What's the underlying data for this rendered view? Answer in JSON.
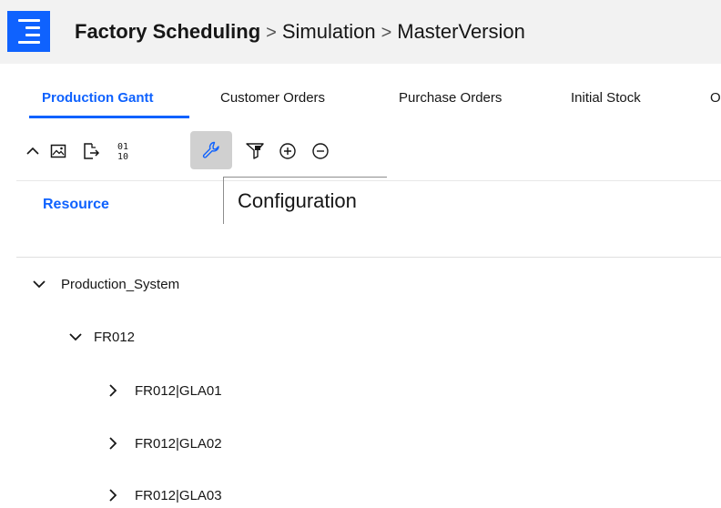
{
  "header": {
    "app_icon": "hamburger-menu-icon",
    "breadcrumb": {
      "app": "Factory Scheduling",
      "separator": ">",
      "level1": "Simulation",
      "level2": "MasterVersion"
    }
  },
  "tabs": [
    {
      "label": "Production Gantt",
      "active": true
    },
    {
      "label": "Customer Orders",
      "active": false
    },
    {
      "label": "Purchase Orders",
      "active": false
    },
    {
      "label": "Initial Stock",
      "active": false
    },
    {
      "label": "O",
      "active": false
    }
  ],
  "toolbar": {
    "items": [
      {
        "icon": "chevron-up-icon"
      },
      {
        "icon": "image-icon"
      },
      {
        "icon": "export-icon"
      },
      {
        "icon": "binary-icon"
      },
      {
        "icon": "wrench-icon",
        "active": true
      },
      {
        "icon": "filter-icon"
      },
      {
        "icon": "zoom-in-icon"
      },
      {
        "icon": "zoom-out-icon"
      }
    ],
    "tooltip": "Configuration"
  },
  "table": {
    "column_header": "Resource"
  },
  "tree": [
    {
      "label": "Production_System",
      "expanded": true,
      "level": 0
    },
    {
      "label": "FR012",
      "expanded": true,
      "level": 1
    },
    {
      "label": "FR012|GLA01",
      "expanded": false,
      "level": 2
    },
    {
      "label": "FR012|GLA02",
      "expanded": false,
      "level": 2
    },
    {
      "label": "FR012|GLA03",
      "expanded": false,
      "level": 2
    }
  ],
  "colors": {
    "accent": "#0f62fe",
    "header_bg": "#f2f2f2",
    "active_tool_bg": "#d0d0d0"
  }
}
